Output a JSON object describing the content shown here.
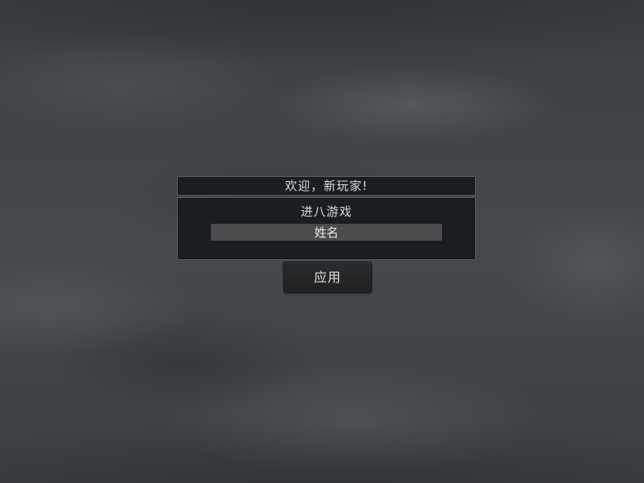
{
  "dialog": {
    "title": "欢迎，新玩家!",
    "heading": "进八游戏",
    "name_input": {
      "value": "",
      "placeholder": "姓名"
    },
    "apply_label": "应用"
  },
  "colors": {
    "panel_background": "#1b1e21",
    "panel_border": "#5b5e62",
    "input_background": "#4c4c4e",
    "button_background": "#242527",
    "text": "#d9d9d9"
  }
}
